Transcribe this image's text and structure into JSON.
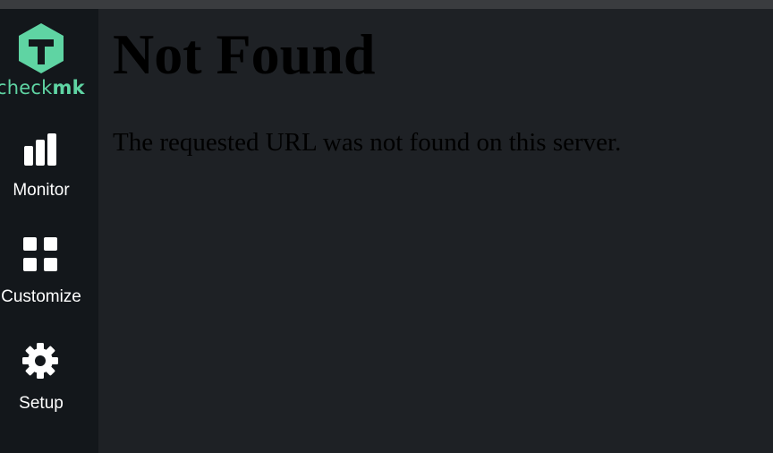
{
  "brand": {
    "name_prefix": "check",
    "name_suffix": "mk",
    "accent_color": "#5fd4a3"
  },
  "nav": {
    "items": [
      {
        "label": "Monitor",
        "icon": "bar-chart-icon"
      },
      {
        "label": "Customize",
        "icon": "grid-icon"
      },
      {
        "label": "Setup",
        "icon": "gear-icon"
      }
    ]
  },
  "content": {
    "title": "Not Found",
    "message": "The requested URL was not found on this server."
  }
}
